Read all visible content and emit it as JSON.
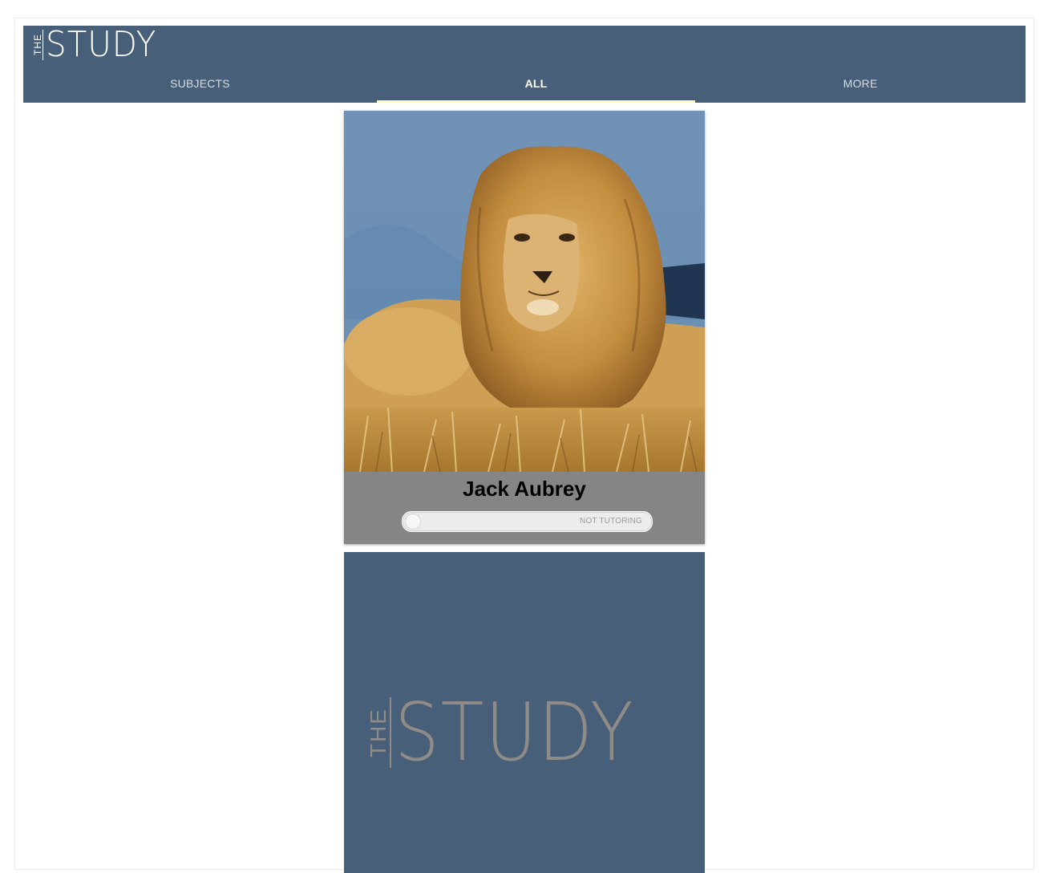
{
  "brand": {
    "logo_small": "THE",
    "logo_large": "STUDY",
    "header_color": "#475f78",
    "active_tab_indicator_color": "#fffcb8"
  },
  "nav": {
    "tabs": [
      {
        "label": "SUBJECTS",
        "active": false
      },
      {
        "label": "ALL",
        "active": true
      },
      {
        "label": "MORE",
        "active": false
      }
    ]
  },
  "tutors": [
    {
      "name": "Jack Aubrey",
      "photo_icon": "lion-photo",
      "status_label": "NOT TUTORING",
      "tutoring": false
    },
    {
      "photo_icon": "the-study-placeholder-logo",
      "placeholder_small": "THE",
      "placeholder_large": "STUDY"
    }
  ]
}
